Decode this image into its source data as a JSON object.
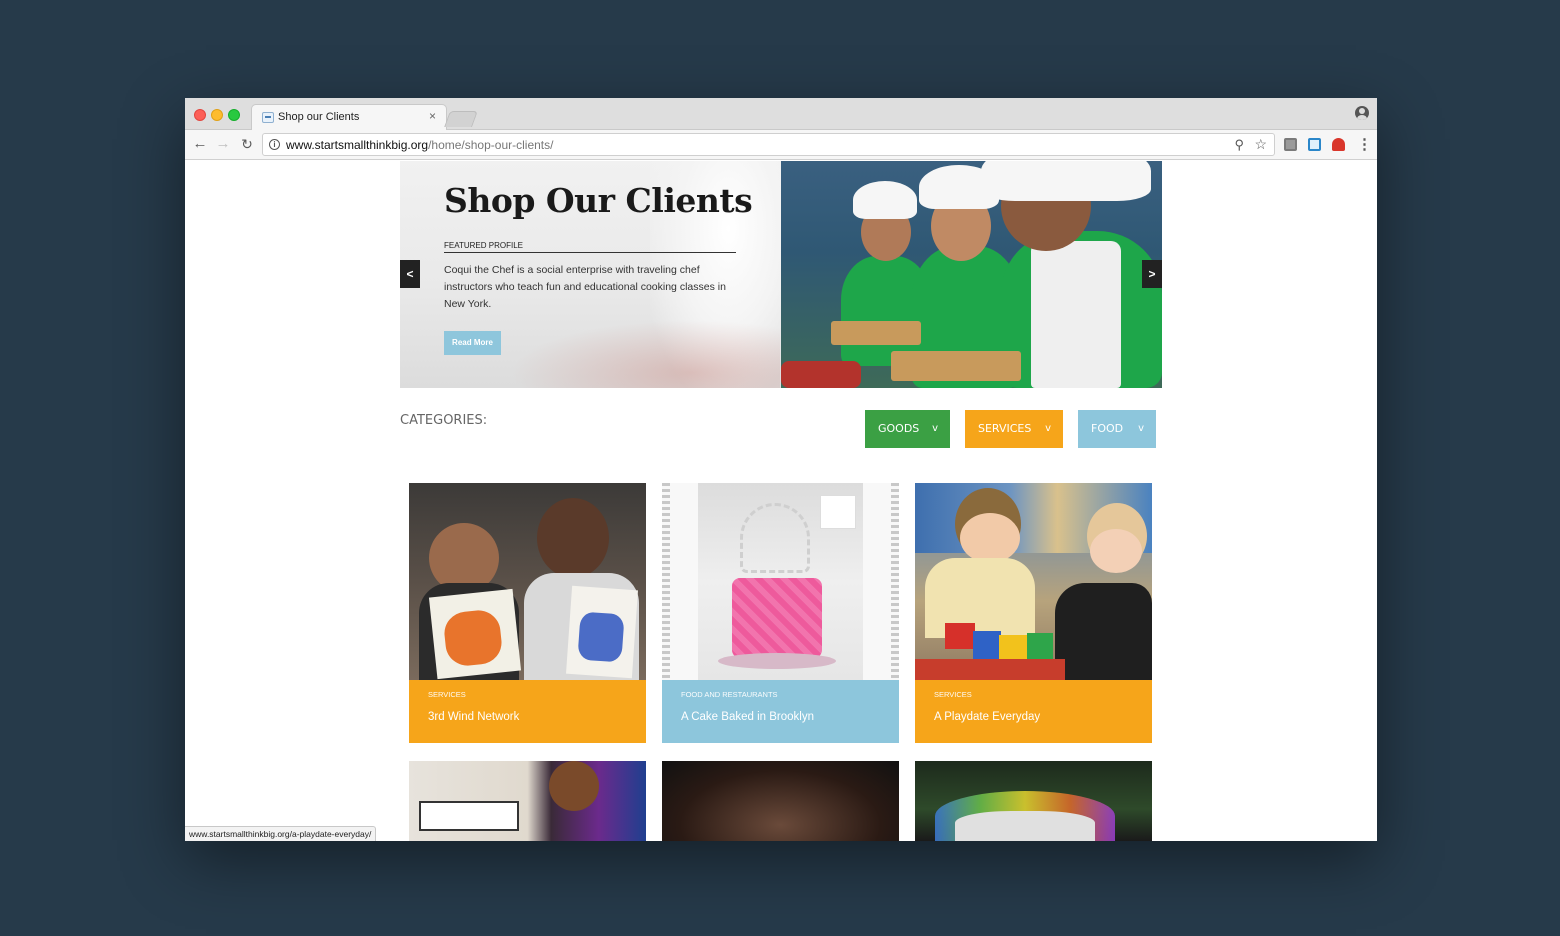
{
  "browser": {
    "tab_title": "Shop our Clients",
    "tab_close": "×",
    "url_host": "www.startsmallthinkbig.org",
    "url_path": "/home/shop-our-clients/",
    "status_url": "www.startsmallthinkbig.org/a-playdate-everyday/"
  },
  "hero": {
    "title": "Shop Our Clients",
    "eyebrow": "FEATURED PROFILE",
    "description": "Coqui the Chef is a social enterprise with traveling chef instructors who teach fun and educational cooking classes in New York.",
    "button_label": "Read More",
    "prev_label": "<",
    "next_label": ">"
  },
  "categories": {
    "label": "CATEGORIES:",
    "buttons": [
      {
        "label": "GOODS",
        "chevron": "v",
        "color": "#3ba044"
      },
      {
        "label": "SERVICES",
        "chevron": "v",
        "color": "#f6a51a"
      },
      {
        "label": "FOOD",
        "chevron": "v",
        "color": "#8dc6dc"
      }
    ]
  },
  "cards": [
    {
      "category": "SERVICES",
      "name": "3rd Wind Network",
      "color": "#f6a51a"
    },
    {
      "category": "FOOD AND RESTAURANTS",
      "name": "A Cake Baked in Brooklyn",
      "color": "#8dc6dc"
    },
    {
      "category": "SERVICES",
      "name": "A Playdate Everyday",
      "color": "#f6a51a"
    }
  ],
  "icons": [
    "info-icon",
    "search-icon",
    "star-icon",
    "back-arrow-icon",
    "forward-arrow-icon",
    "reload-icon",
    "profile-icon",
    "menu-icon"
  ]
}
